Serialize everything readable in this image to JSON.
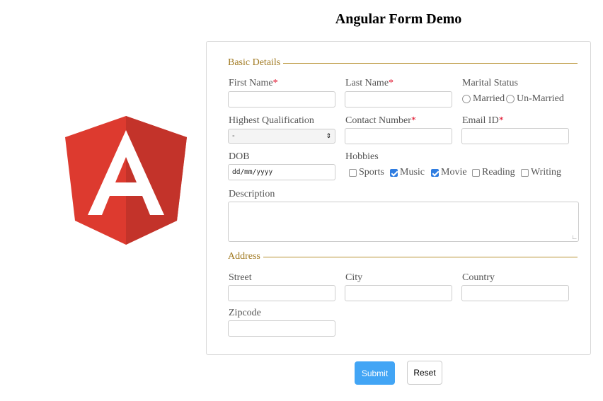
{
  "page": {
    "title": "Angular Form Demo"
  },
  "logo": {
    "icon": "angular-logo-icon",
    "colors": {
      "red": "#dd3a2f",
      "dark_red": "#c3332a",
      "letter": "#ffffff"
    }
  },
  "basic": {
    "legend": "Basic Details",
    "first_name": {
      "label": "First Name",
      "required": "*"
    },
    "last_name": {
      "label": "Last Name",
      "required": "*"
    },
    "marital": {
      "label": "Marital Status",
      "options": [
        "Married",
        "Un-Married"
      ]
    },
    "qualification": {
      "label": "Highest Qualification",
      "selected": "-"
    },
    "contact": {
      "label": "Contact Number",
      "required": "*"
    },
    "email": {
      "label": "Email ID",
      "required": "*"
    },
    "dob": {
      "label": "DOB",
      "value": "dd/mm/yyyy"
    },
    "hobbies": {
      "label": "Hobbies",
      "items": [
        {
          "label": "Sports",
          "checked": false
        },
        {
          "label": "Music",
          "checked": true
        },
        {
          "label": "Movie",
          "checked": true
        },
        {
          "label": "Reading",
          "checked": false
        },
        {
          "label": "Writing",
          "checked": false
        }
      ]
    },
    "description": {
      "label": "Description"
    }
  },
  "address": {
    "legend": "Address",
    "street": {
      "label": "Street"
    },
    "city": {
      "label": "City"
    },
    "country": {
      "label": "Country"
    },
    "zipcode": {
      "label": "Zipcode"
    }
  },
  "buttons": {
    "submit": "Submit",
    "reset": "Reset"
  },
  "colors": {
    "accent": "#42a5f5",
    "legend": "#a17a22",
    "required": "#e0102a",
    "checked": "#2f7de1"
  }
}
